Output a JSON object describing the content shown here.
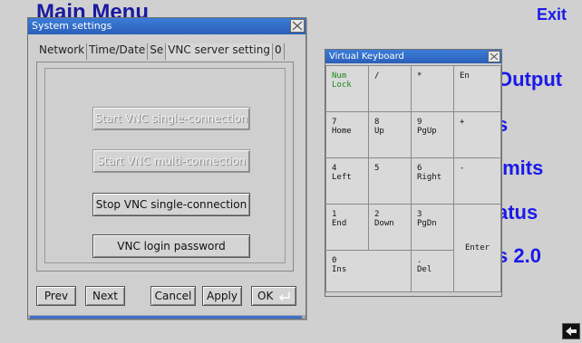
{
  "background": {
    "title": "Main Menu",
    "exit_label": "Exit",
    "items": [
      "Output",
      "s",
      "imits",
      "atus",
      "s 2.0"
    ]
  },
  "system_settings": {
    "title": "System settings",
    "tabs": [
      "Network",
      "Time/Date",
      "Se",
      "VNC server setting",
      "0"
    ],
    "buttons": {
      "start_single": "Start VNC single-connection",
      "start_multi": "Start VNC multi-connection",
      "stop_single": "Stop VNC single-connection",
      "login_password": "VNC login password"
    },
    "footer": {
      "prev": "Prev",
      "next": "Next",
      "cancel": "Cancel",
      "apply": "Apply",
      "ok": "OK"
    }
  },
  "virtual_keyboard": {
    "title": "Virtual Keyboard",
    "keys": {
      "numlock": "Num\nLock",
      "slash": "/",
      "star": "*",
      "en": "En",
      "k7": "7\nHome",
      "k8": "8\nUp",
      "k9": "9\nPgUp",
      "plus": "+",
      "k4": "4\nLeft",
      "k5": "5",
      "k6": "6\nRight",
      "minus": "-",
      "k1": "1\nEnd",
      "k2": "2\nDown",
      "k3": "3\nPgDn",
      "enter": "Enter",
      "k0": "0\nIns",
      "dot": ".\nDel"
    }
  }
}
